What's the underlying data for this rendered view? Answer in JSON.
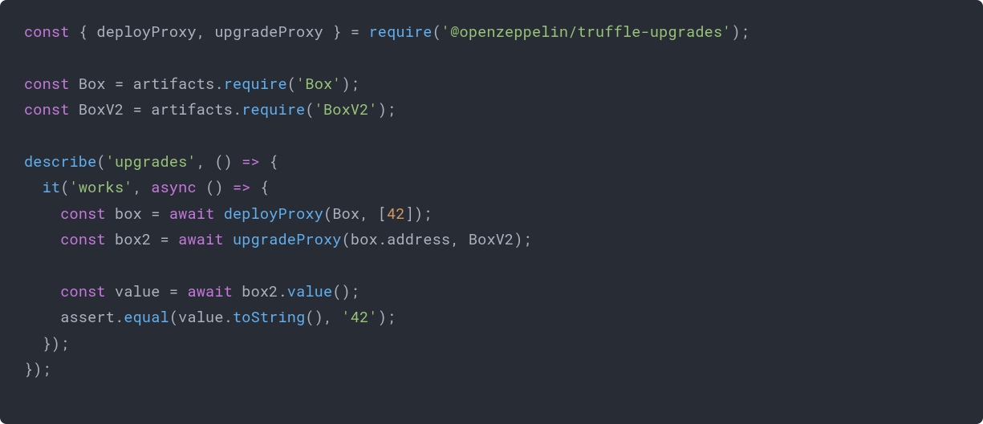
{
  "code": {
    "tokens": [
      [
        {
          "t": "const",
          "c": "kw"
        },
        {
          "t": " { deployProxy, upgradeProxy } = ",
          "c": "plain"
        },
        {
          "t": "require",
          "c": "fn"
        },
        {
          "t": "(",
          "c": "plain"
        },
        {
          "t": "'@openzeppelin/truffle-upgrades'",
          "c": "str"
        },
        {
          "t": ");",
          "c": "plain"
        }
      ],
      [],
      [
        {
          "t": "const",
          "c": "kw"
        },
        {
          "t": " Box = artifacts.",
          "c": "plain"
        },
        {
          "t": "require",
          "c": "fn"
        },
        {
          "t": "(",
          "c": "plain"
        },
        {
          "t": "'Box'",
          "c": "str"
        },
        {
          "t": ");",
          "c": "plain"
        }
      ],
      [
        {
          "t": "const",
          "c": "kw"
        },
        {
          "t": " BoxV2 = artifacts.",
          "c": "plain"
        },
        {
          "t": "require",
          "c": "fn"
        },
        {
          "t": "(",
          "c": "plain"
        },
        {
          "t": "'BoxV2'",
          "c": "str"
        },
        {
          "t": ");",
          "c": "plain"
        }
      ],
      [],
      [
        {
          "t": "describe",
          "c": "fn"
        },
        {
          "t": "(",
          "c": "plain"
        },
        {
          "t": "'upgrades'",
          "c": "str"
        },
        {
          "t": ", () ",
          "c": "plain"
        },
        {
          "t": "=>",
          "c": "kw"
        },
        {
          "t": " {",
          "c": "plain"
        }
      ],
      [
        {
          "t": "  ",
          "c": "plain"
        },
        {
          "t": "it",
          "c": "fn"
        },
        {
          "t": "(",
          "c": "plain"
        },
        {
          "t": "'works'",
          "c": "str"
        },
        {
          "t": ", ",
          "c": "plain"
        },
        {
          "t": "async",
          "c": "kw"
        },
        {
          "t": " () ",
          "c": "plain"
        },
        {
          "t": "=>",
          "c": "kw"
        },
        {
          "t": " {",
          "c": "plain"
        }
      ],
      [
        {
          "t": "    ",
          "c": "plain"
        },
        {
          "t": "const",
          "c": "kw"
        },
        {
          "t": " box = ",
          "c": "plain"
        },
        {
          "t": "await",
          "c": "kw"
        },
        {
          "t": " ",
          "c": "plain"
        },
        {
          "t": "deployProxy",
          "c": "fn"
        },
        {
          "t": "(Box, [",
          "c": "plain"
        },
        {
          "t": "42",
          "c": "num"
        },
        {
          "t": "]);",
          "c": "plain"
        }
      ],
      [
        {
          "t": "    ",
          "c": "plain"
        },
        {
          "t": "const",
          "c": "kw"
        },
        {
          "t": " box2 = ",
          "c": "plain"
        },
        {
          "t": "await",
          "c": "kw"
        },
        {
          "t": " ",
          "c": "plain"
        },
        {
          "t": "upgradeProxy",
          "c": "fn"
        },
        {
          "t": "(box.address, BoxV2);",
          "c": "plain"
        }
      ],
      [],
      [
        {
          "t": "    ",
          "c": "plain"
        },
        {
          "t": "const",
          "c": "kw"
        },
        {
          "t": " value = ",
          "c": "plain"
        },
        {
          "t": "await",
          "c": "kw"
        },
        {
          "t": " box2.",
          "c": "plain"
        },
        {
          "t": "value",
          "c": "fn"
        },
        {
          "t": "();",
          "c": "plain"
        }
      ],
      [
        {
          "t": "    assert.",
          "c": "plain"
        },
        {
          "t": "equal",
          "c": "fn"
        },
        {
          "t": "(value.",
          "c": "plain"
        },
        {
          "t": "toString",
          "c": "fn"
        },
        {
          "t": "(), ",
          "c": "plain"
        },
        {
          "t": "'42'",
          "c": "str"
        },
        {
          "t": ");",
          "c": "plain"
        }
      ],
      [
        {
          "t": "  });",
          "c": "plain"
        }
      ],
      [
        {
          "t": "});",
          "c": "plain"
        }
      ]
    ]
  }
}
